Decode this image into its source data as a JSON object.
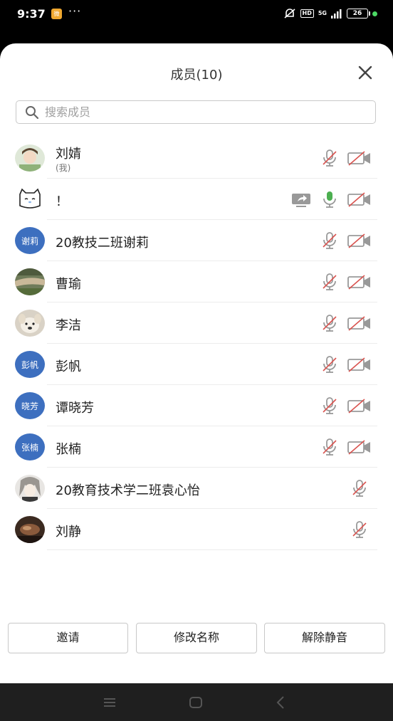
{
  "status_bar": {
    "time": "9:37",
    "app_badge": "微",
    "more": "···",
    "hd": "HD",
    "network": "5G",
    "battery": "26"
  },
  "sheet": {
    "title": "成员(10)",
    "search_placeholder": "搜索成员"
  },
  "members": [
    {
      "name": "刘婧",
      "sub": "(我)",
      "avatar": "photo-girl",
      "mic": "muted",
      "cam": "off"
    },
    {
      "name": "！",
      "avatar": "cat-drawing",
      "share": true,
      "mic": "on",
      "cam": "off"
    },
    {
      "name": "20教技二班谢莉",
      "avatar_text": "谢莉",
      "mic": "muted",
      "cam": "off"
    },
    {
      "name": "曹瑜",
      "avatar": "photo-landscape",
      "mic": "muted",
      "cam": "off"
    },
    {
      "name": "李洁",
      "avatar": "photo-dog",
      "mic": "muted",
      "cam": "off"
    },
    {
      "name": "彭帆",
      "avatar_text": "彭帆",
      "mic": "muted",
      "cam": "off"
    },
    {
      "name": "谭晓芳",
      "avatar_text": "晓芳",
      "mic": "muted",
      "cam": "off"
    },
    {
      "name": "张楠",
      "avatar_text": "张楠",
      "mic": "muted",
      "cam": "off"
    },
    {
      "name": "20教育技术学二班袁心怡",
      "avatar": "photo-anime",
      "mic": "muted"
    },
    {
      "name": "刘静",
      "avatar": "photo-dark",
      "mic": "muted"
    }
  ],
  "actions": {
    "invite": "邀请",
    "rename": "修改名称",
    "unmute": "解除静音"
  },
  "colors": {
    "accent": "#3d6fbf",
    "mic_on": "#4caf50",
    "muted_slash": "#d9534f"
  }
}
